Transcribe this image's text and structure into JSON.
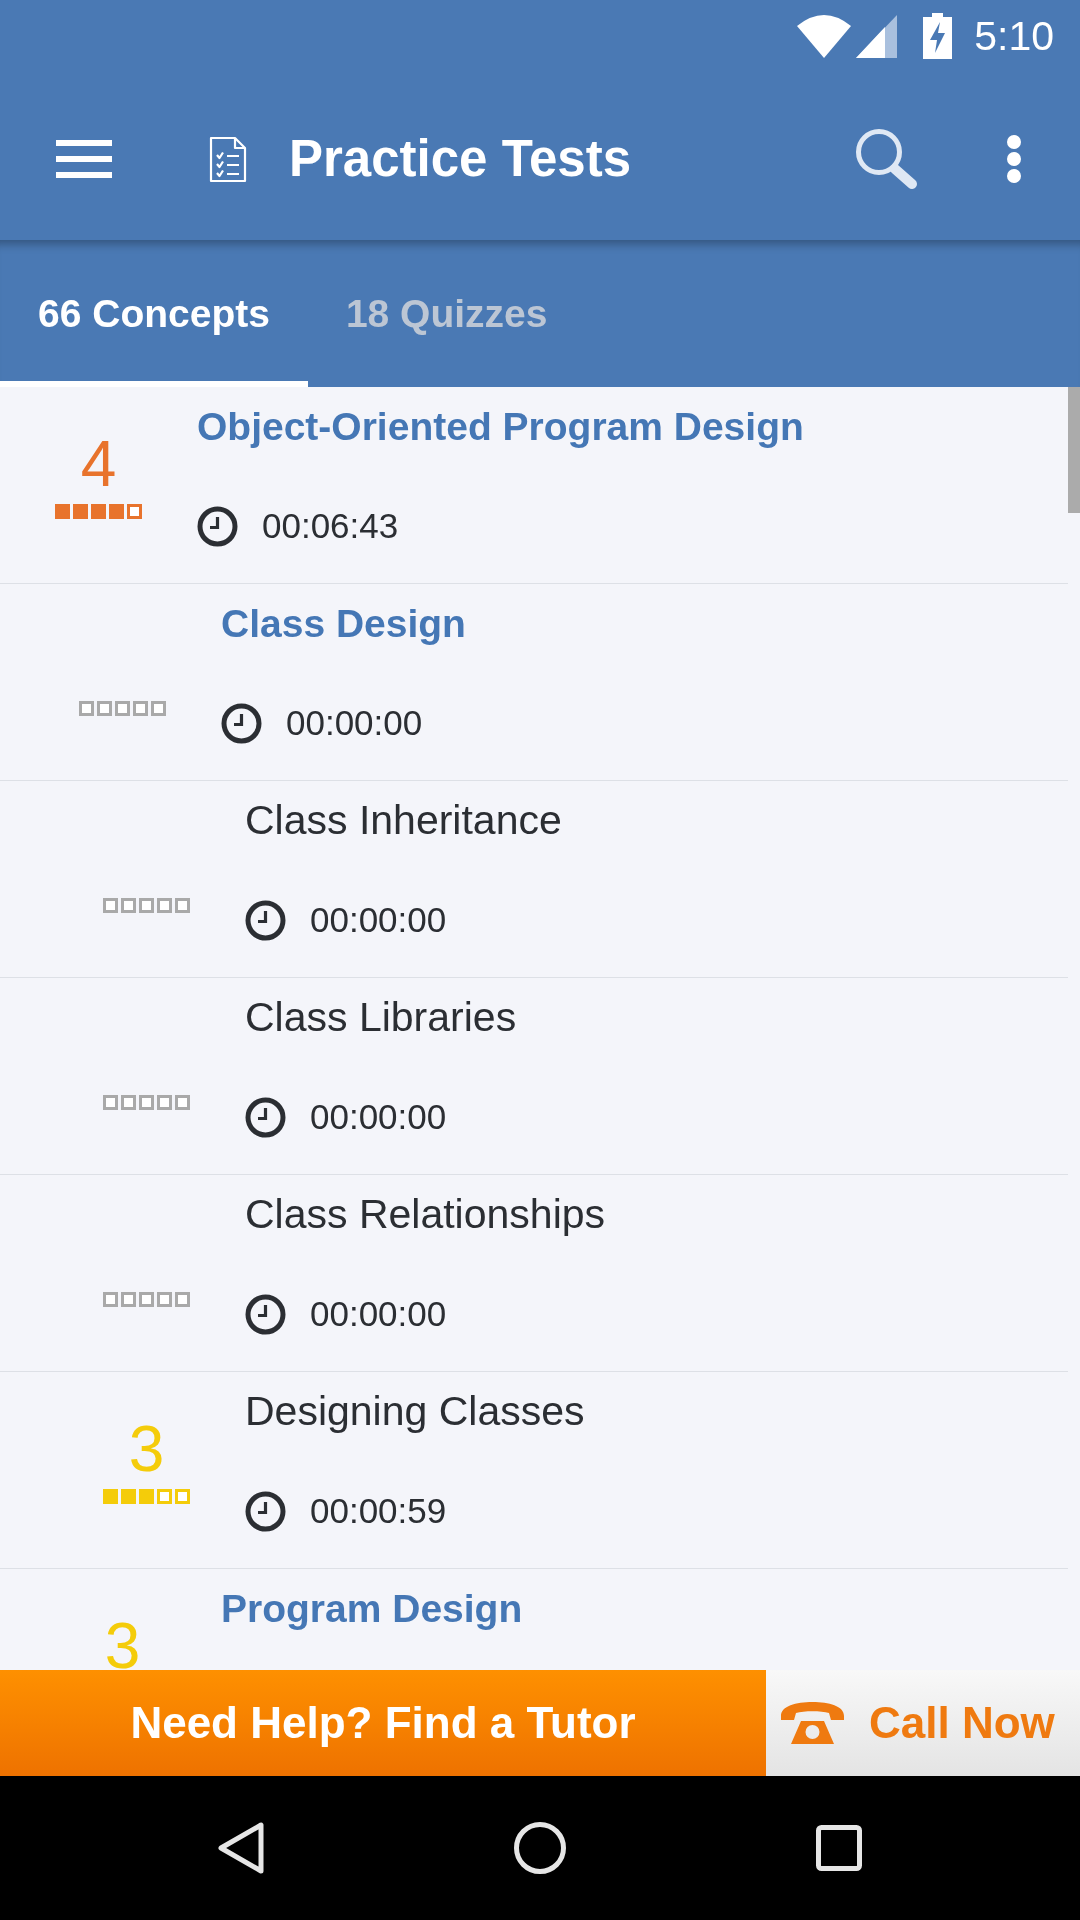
{
  "status_bar": {
    "time": "5:10"
  },
  "toolbar": {
    "title": "Practice Tests"
  },
  "tabs": [
    {
      "label": "66 Concepts",
      "selected": true
    },
    {
      "label": "18 Quizzes",
      "selected": false
    }
  ],
  "concepts": [
    {
      "kind": "topic",
      "title": "Object-Oriented Program Design",
      "score": "4",
      "stars": 4,
      "color": "#e8732c",
      "time": "00:06:43",
      "children": [
        {
          "kind": "topic",
          "title": "Class Design",
          "stars": 0,
          "color": "#a9a9a9",
          "time": "00:00:00",
          "children": [
            {
              "kind": "concept",
              "title": "Class Inheritance",
              "stars": 0,
              "color": "#a9a9a9",
              "time": "00:00:00"
            },
            {
              "kind": "concept",
              "title": "Class Libraries",
              "stars": 0,
              "color": "#a9a9a9",
              "time": "00:00:00"
            },
            {
              "kind": "concept",
              "title": "Class Relationships",
              "stars": 0,
              "color": "#a9a9a9",
              "time": "00:00:00"
            },
            {
              "kind": "concept",
              "title": "Designing Classes",
              "score": "3",
              "stars": 3,
              "color": "#f4cc0a",
              "time": "00:00:59"
            }
          ]
        },
        {
          "kind": "topic",
          "title": "Program Design",
          "score": "3",
          "color": "#f4cc0a"
        }
      ]
    }
  ],
  "help_banner": {
    "text": "Need Help? Find a Tutor",
    "call_label": "Call Now"
  }
}
